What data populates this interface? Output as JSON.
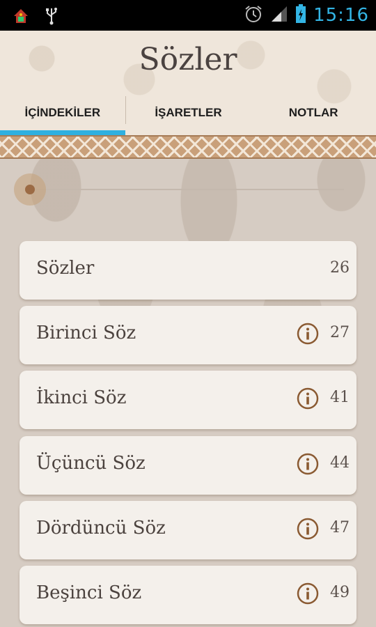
{
  "status_bar": {
    "time": "15:16",
    "icons": [
      "app-icon",
      "usb-icon",
      "alarm-icon",
      "signal-icon",
      "battery-icon"
    ]
  },
  "header": {
    "title": "Sözler"
  },
  "tabs": [
    {
      "label": "İÇİNDEKİLER",
      "active": true
    },
    {
      "label": "İŞARETLER",
      "active": false
    },
    {
      "label": "NOTLAR",
      "active": false
    }
  ],
  "slider": {
    "value_fraction": 0.0
  },
  "list": [
    {
      "label": "Sözler",
      "page": "26",
      "info": false
    },
    {
      "label": "Birinci Söz",
      "page": "27",
      "info": true
    },
    {
      "label": "İkinci Söz",
      "page": "41",
      "info": true
    },
    {
      "label": "Üçüncü Söz",
      "page": "44",
      "info": true
    },
    {
      "label": "Dördüncü Söz",
      "page": "47",
      "info": true
    },
    {
      "label": "Beşinci Söz",
      "page": "49",
      "info": true
    }
  ],
  "colors": {
    "accent": "#2fb0e0",
    "status_time": "#33b5e5",
    "icon_brown": "#8a5a32"
  }
}
